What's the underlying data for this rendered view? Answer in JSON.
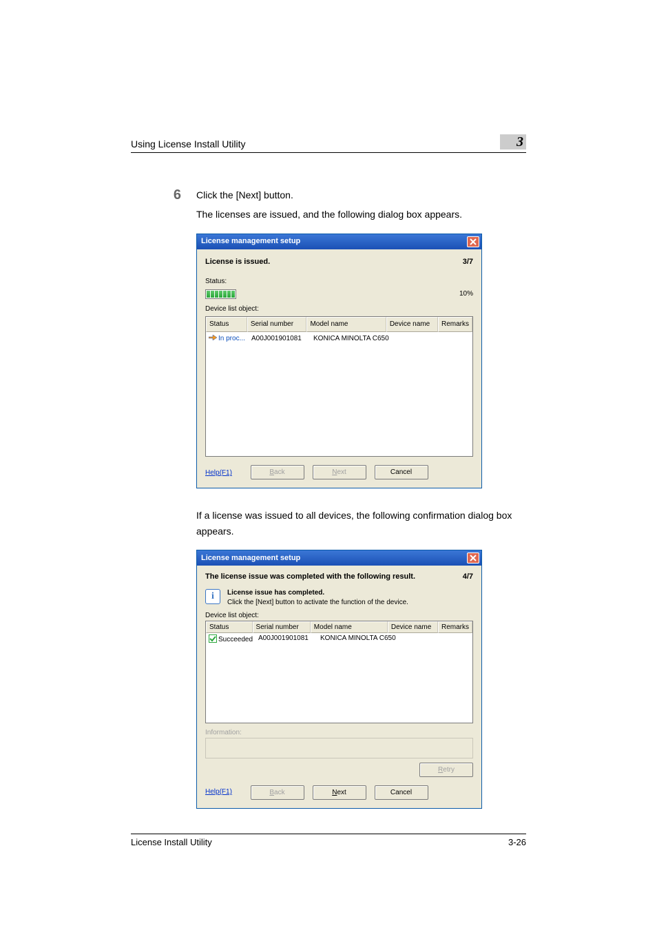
{
  "header": {
    "title": "Using License Install Utility",
    "chapter": "3"
  },
  "step": {
    "number": "6",
    "line1": "Click the [Next] button.",
    "line2": "The licenses are issued, and the following dialog box appears."
  },
  "dialog1": {
    "title": "License management setup",
    "heading": "License is issued.",
    "page": "3/7",
    "status_label": "Status:",
    "percent": "10%",
    "list_label": "Device list object:",
    "columns": {
      "status": "Status",
      "serial": "Serial number",
      "model": "Model name",
      "device": "Device name",
      "remarks": "Remarks"
    },
    "row": {
      "status": "In proc...",
      "serial": "A00J001901081",
      "model": "KONICA MINOLTA C650",
      "device": "",
      "remarks": ""
    },
    "buttons": {
      "help": "Help(F1)",
      "back": "Back",
      "next": "Next",
      "cancel": "Cancel"
    }
  },
  "mid_para": "If a license was issued to all devices, the following confirmation dialog box appears.",
  "dialog2": {
    "title": "License management setup",
    "heading": "The license issue was completed with the following result.",
    "page": "4/7",
    "info_bold": "License issue has completed.",
    "info_line": "Click the [Next] button to activate the function of the device.",
    "list_label": "Device list object:",
    "columns": {
      "status": "Status",
      "serial": "Serial number",
      "model": "Model name",
      "device": "Device name",
      "remarks": "Remarks"
    },
    "row": {
      "status": "Succeeded",
      "serial": "A00J001901081",
      "model": "KONICA MINOLTA C650",
      "device": "",
      "remarks": ""
    },
    "info_label": "Information:",
    "retry": "Retry",
    "buttons": {
      "help": "Help(F1)",
      "back": "Back",
      "next": "Next",
      "cancel": "Cancel"
    }
  },
  "footer": {
    "left": "License Install Utility",
    "right": "3-26"
  }
}
